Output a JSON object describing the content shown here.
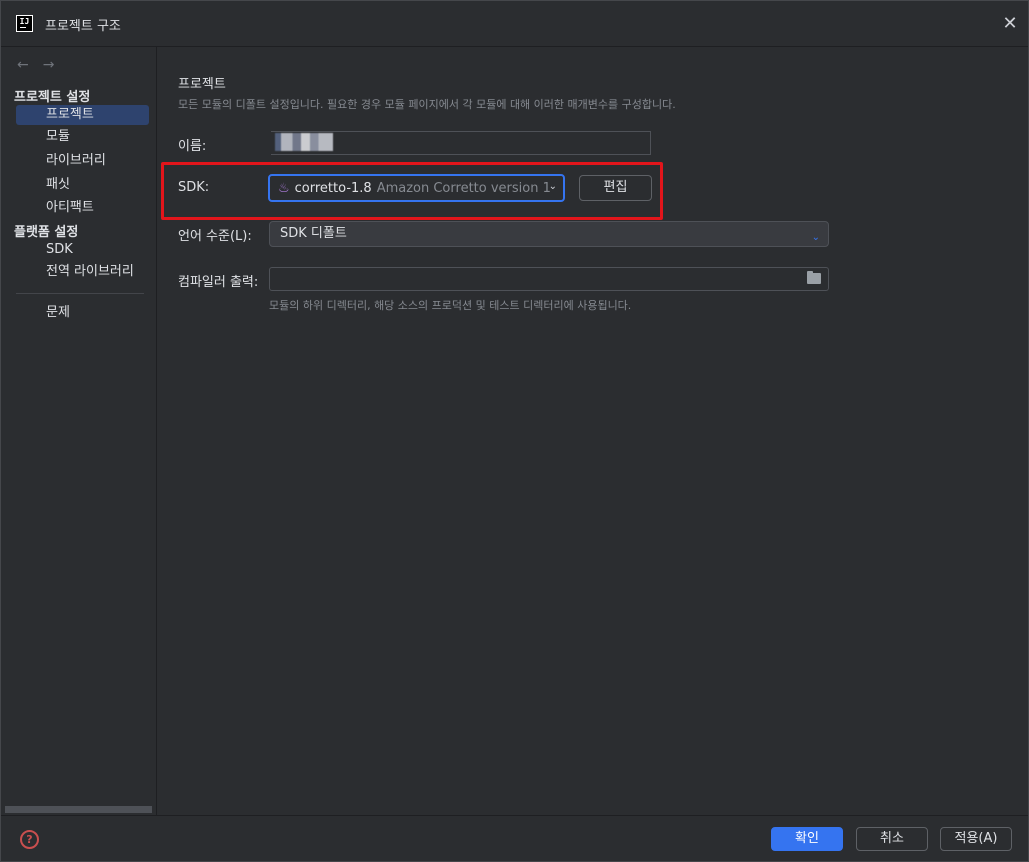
{
  "window": {
    "title": "프로젝트 구조",
    "close_symbol": "✕"
  },
  "sidebar": {
    "back_symbol": "←",
    "forward_symbol": "→",
    "section_project": "프로젝트 설정",
    "items_project": [
      "프로젝트",
      "모듈",
      "라이브러리",
      "패싯",
      "아티팩트"
    ],
    "section_platform": "플랫폼 설정",
    "items_platform": [
      "SDK",
      "전역 라이브러리"
    ],
    "problems": "문제",
    "selected": "프로젝트"
  },
  "main": {
    "heading": "프로젝트",
    "subheading": "모든 모듈의 디폴트 설정입니다. 필요한 경우 모듈 페이지에서 각 모듈에 대해 이러한 매개변수를 구성합니다.",
    "name_label": "이름:",
    "sdk_label": "SDK:",
    "sdk_name": "corretto-1.8",
    "sdk_desc": "Amazon Corretto version 1",
    "edit_button": "편집",
    "lang_label": "언어 수준(L):",
    "lang_value": "SDK 디폴트",
    "output_label": "컴파일러 출력:",
    "output_value": "",
    "output_hint": "모듈의 하위 디렉터리, 해당 소스의 프로덕션 및 테스트 디렉터리에 사용됩니다."
  },
  "footer": {
    "help_symbol": "?",
    "ok": "확인",
    "cancel": "취소",
    "apply": "적용(A)"
  },
  "colors": {
    "accent": "#3574f0",
    "highlight": "#e2151b",
    "selection": "#2e436e"
  }
}
